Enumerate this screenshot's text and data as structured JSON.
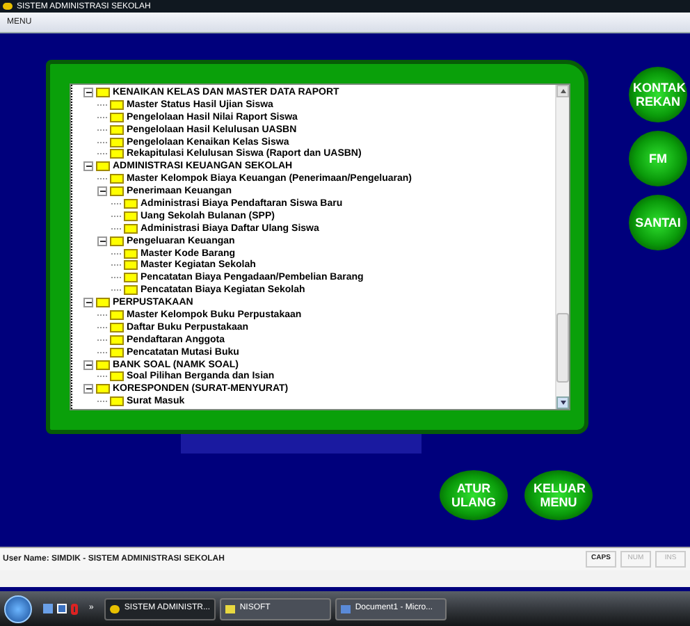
{
  "window": {
    "title": "SISTEM ADMINISTRASI SEKOLAH"
  },
  "menu": [
    "MENU"
  ],
  "tree": [
    {
      "label": "KENAIKAN KELAS DAN MASTER DATA RAPORT",
      "expanded": true,
      "children": [
        {
          "label": "Master Status Hasil Ujian Siswa"
        },
        {
          "label": "Pengelolaan Hasil Nilai Raport Siswa"
        },
        {
          "label": "Pengelolaan Hasil Kelulusan UASBN"
        },
        {
          "label": "Pengelolaan Kenaikan Kelas Siswa"
        },
        {
          "label": "Rekapitulasi Kelulusan Siswa (Raport dan UASBN)"
        }
      ]
    },
    {
      "label": "ADMINISTRASI KEUANGAN SEKOLAH",
      "expanded": true,
      "children": [
        {
          "label": "Master Kelompok Biaya Keuangan (Penerimaan/Pengeluaran)"
        },
        {
          "label": "Penerimaan Keuangan",
          "expanded": true,
          "children": [
            {
              "label": "Administrasi Biaya Pendaftaran Siswa Baru"
            },
            {
              "label": "Uang Sekolah Bulanan (SPP)"
            },
            {
              "label": "Administrasi Biaya Daftar Ulang Siswa"
            }
          ]
        },
        {
          "label": "Pengeluaran Keuangan",
          "expanded": true,
          "children": [
            {
              "label": "Master Kode Barang"
            },
            {
              "label": "Master Kegiatan Sekolah"
            },
            {
              "label": "Pencatatan Biaya Pengadaan/Pembelian Barang"
            },
            {
              "label": "Pencatatan Biaya Kegiatan Sekolah"
            }
          ]
        }
      ]
    },
    {
      "label": "PERPUSTAKAAN",
      "expanded": true,
      "children": [
        {
          "label": "Master Kelompok Buku Perpustakaan"
        },
        {
          "label": "Daftar Buku Perpustakaan"
        },
        {
          "label": "Pendaftaran Anggota"
        },
        {
          "label": "Pencatatan Mutasi Buku"
        }
      ]
    },
    {
      "label": "BANK SOAL (NAMK SOAL)",
      "expanded": true,
      "children": [
        {
          "label": "Soal Pilihan Berganda dan Isian"
        }
      ]
    },
    {
      "label": "KORESPONDEN (SURAT-MENYURAT)",
      "expanded": true,
      "children": [
        {
          "label": "Surat Masuk"
        }
      ]
    }
  ],
  "side_buttons": [
    "KONTAK REKAN",
    "FM",
    "SANTAI"
  ],
  "bottom_buttons": [
    "ATUR ULANG",
    "KELUAR MENU"
  ],
  "status_bar": {
    "text": "User Name: SIMDIK - SISTEM ADMINISTRASI SEKOLAH",
    "indicators": [
      {
        "label": "CAPS",
        "on": true
      },
      {
        "label": "NUM",
        "on": false
      },
      {
        "label": "INS",
        "on": false
      }
    ]
  },
  "taskbar": {
    "overflow": "»",
    "tasks": [
      {
        "label": "SISTEM ADMINISTR...",
        "selected": true
      },
      {
        "label": "NISOFT",
        "selected": false
      },
      {
        "label": "Document1 - Micro...",
        "selected": false
      }
    ]
  }
}
